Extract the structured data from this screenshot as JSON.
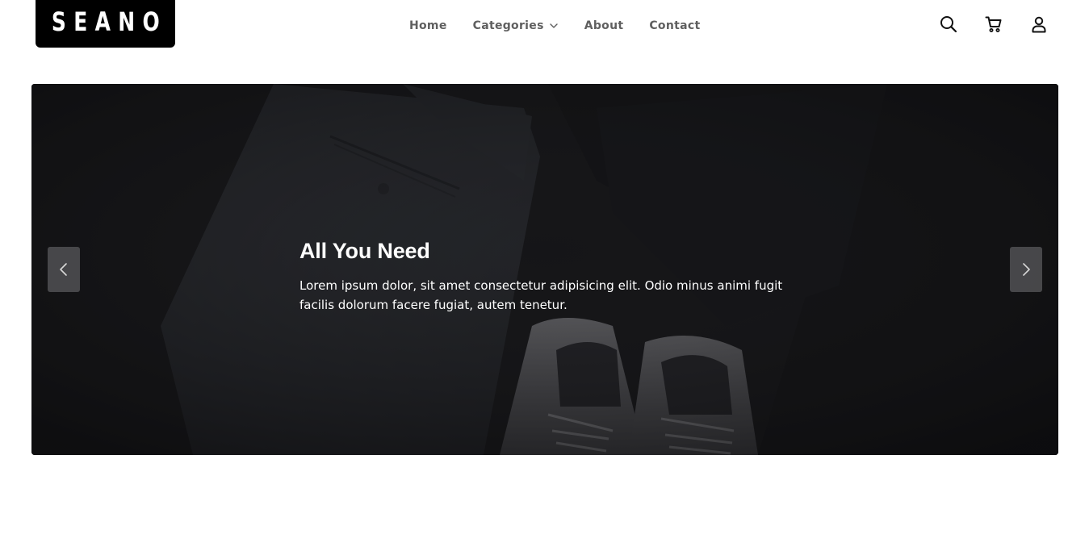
{
  "brand": {
    "logo_text": "SEANO"
  },
  "nav": {
    "items": [
      {
        "label": "Home"
      },
      {
        "label": "Categories",
        "has_dropdown": true
      },
      {
        "label": "About"
      },
      {
        "label": "Contact"
      }
    ]
  },
  "header_icons": [
    "search-icon",
    "cart-icon",
    "user-icon"
  ],
  "hero": {
    "title": "All You Need",
    "description": "Lorem ipsum dolor, sit amet consectetur adipisicing elit. Odio minus animi fugit facilis dolorum facere fugiat, autem tenetur.",
    "prev_icon": "chevron-left-icon",
    "next_icon": "chevron-right-icon"
  },
  "colors": {
    "logo_bg": "#000000",
    "nav_text": "#5f5f5f",
    "hero_bg": "#1c1c1d",
    "hero_text": "#ffffff"
  }
}
